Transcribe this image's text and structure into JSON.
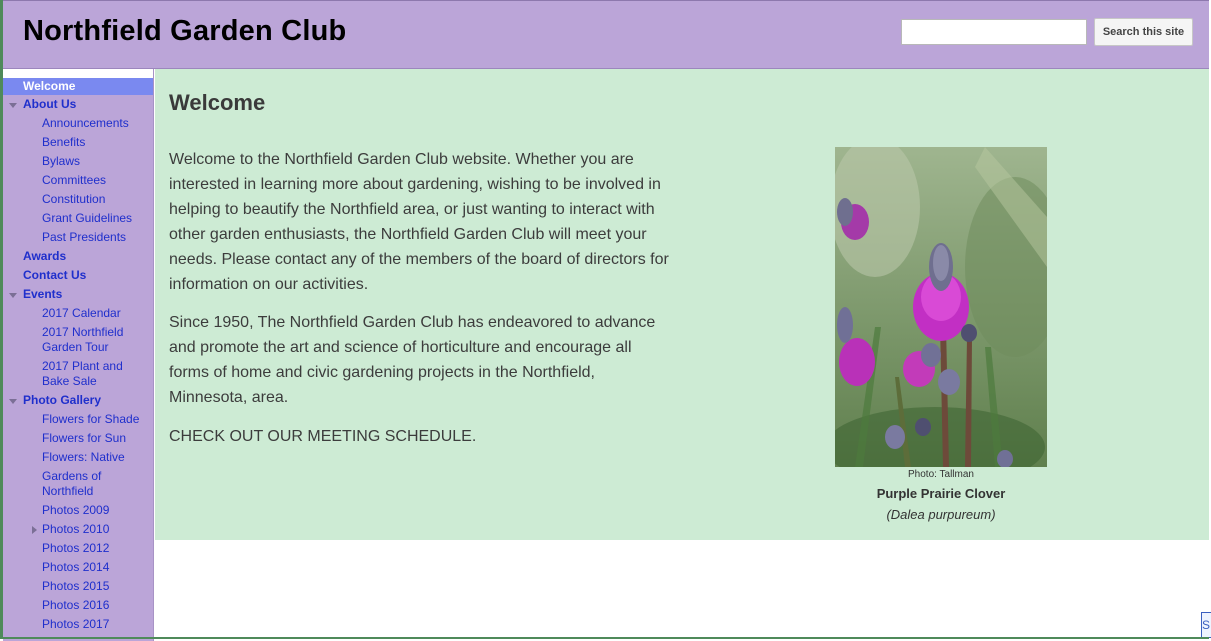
{
  "header": {
    "site_title": "Northfield Garden Club",
    "search_placeholder": "",
    "search_button_label": "Search this site"
  },
  "sidebar": {
    "items": [
      {
        "label": "Welcome",
        "level": 1,
        "active": true
      },
      {
        "label": "About Us",
        "level": 1,
        "expanded": true
      },
      {
        "label": "Announcements",
        "level": 2
      },
      {
        "label": "Benefits",
        "level": 2
      },
      {
        "label": "Bylaws",
        "level": 2
      },
      {
        "label": "Committees",
        "level": 2
      },
      {
        "label": "Constitution",
        "level": 2
      },
      {
        "label": "Grant Guidelines",
        "level": 2
      },
      {
        "label": "Past Presidents",
        "level": 2
      },
      {
        "label": "Awards",
        "level": 1
      },
      {
        "label": "Contact Us",
        "level": 1
      },
      {
        "label": "Events",
        "level": 1,
        "expanded": true
      },
      {
        "label": "2017 Calendar",
        "level": 2
      },
      {
        "label": "2017 Northfield Garden Tour",
        "level": 2
      },
      {
        "label": "2017 Plant and Bake Sale",
        "level": 2
      },
      {
        "label": "Photo Gallery",
        "level": 1,
        "expanded": true
      },
      {
        "label": "Flowers for Shade",
        "level": 2
      },
      {
        "label": "Flowers for Sun",
        "level": 2
      },
      {
        "label": "Flowers: Native",
        "level": 2
      },
      {
        "label": "Gardens of Northfield",
        "level": 2
      },
      {
        "label": "Photos 2009",
        "level": 2
      },
      {
        "label": "Photos 2010",
        "level": 2,
        "collapsed": true
      },
      {
        "label": "Photos 2012",
        "level": 2
      },
      {
        "label": "Photos 2014",
        "level": 2
      },
      {
        "label": "Photos 2015",
        "level": 2
      },
      {
        "label": "Photos 2016",
        "level": 2
      },
      {
        "label": "Photos 2017",
        "level": 2
      }
    ]
  },
  "main": {
    "title": "Welcome",
    "intro": "Welcome to the Northfield Garden Club website.  Whether you are interested in learning more about gardening, wishing to be involved in helping to beautify the Northfield area, or just wanting to interact with other garden enthusiasts, the Northfield Garden Club will meet your needs.  Please contact any of the members of the board of directors for information on our activities.",
    "history": "Since 1950, The Northfield Garden Club has endeavored to advance and promote the art and science of horticulture and encourage all forms of home and civic gardening projects in the Northfield, Minnesota, area.",
    "schedule_link": "CHECK OUT OUR MEETING SCHEDULE.",
    "photo": {
      "credit": "Photo: Tallman",
      "name": "Purple Prairie Clover",
      "latin": "(Dalea purpureum)"
    }
  },
  "colors": {
    "header_bg": "#bba5d8",
    "sidebar_bg": "#bba5d8",
    "content_bg": "#cdebd4",
    "nav_link": "#1f2fcc",
    "nav_active_bg": "#7a89f0"
  }
}
